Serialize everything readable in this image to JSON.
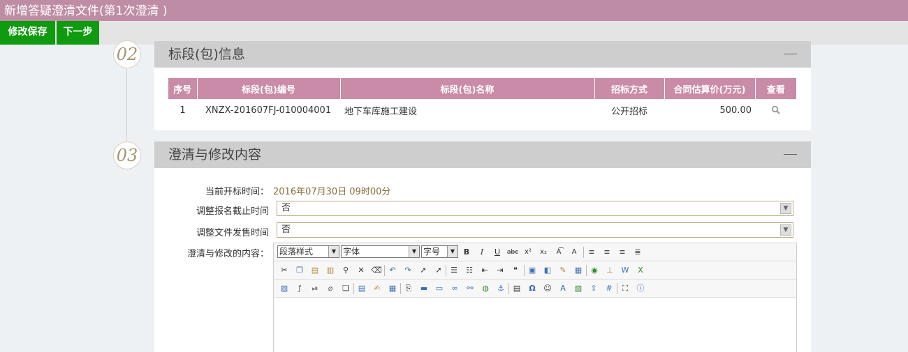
{
  "window": {
    "title": "新增答疑澄清文件(第1次澄清 )"
  },
  "toolbar": {
    "save_label": "修改保存",
    "next_label": "下一步"
  },
  "section2": {
    "number": "02",
    "title": "标段(包)信息",
    "table": {
      "headers": [
        "序号",
        "标段(包)编号",
        "标段(包)名称",
        "招标方式",
        "合同估算价(万元)",
        "查看"
      ],
      "rows": [
        {
          "index": "1",
          "code": "XNZX-201607FJ-010004001",
          "name": "地下车库施工建设",
          "method": "公开招标",
          "price": "500.00",
          "view_icon": "search-icon"
        }
      ]
    }
  },
  "section3": {
    "number": "03",
    "title": "澄清与修改内容",
    "fields": {
      "open_time_label": "当前开标时间：",
      "open_time_value": "2016年07月30日 09时00分",
      "adjust_signup_label": "调整报名截止时间",
      "adjust_signup_value": "否",
      "adjust_doc_sale_label": "调整文件发售时间",
      "adjust_doc_sale_value": "否",
      "content_label": "澄清与修改的内容："
    },
    "editor": {
      "paragraph_style": "段落样式",
      "font": "字体",
      "font_size": "字号"
    }
  },
  "colors": {
    "title_bar": "#bf8ca6",
    "button_green": "#0f9a0f",
    "table_header": "#c98ba7",
    "section_header": "#cecece",
    "date_text": "#8a6d3b"
  }
}
